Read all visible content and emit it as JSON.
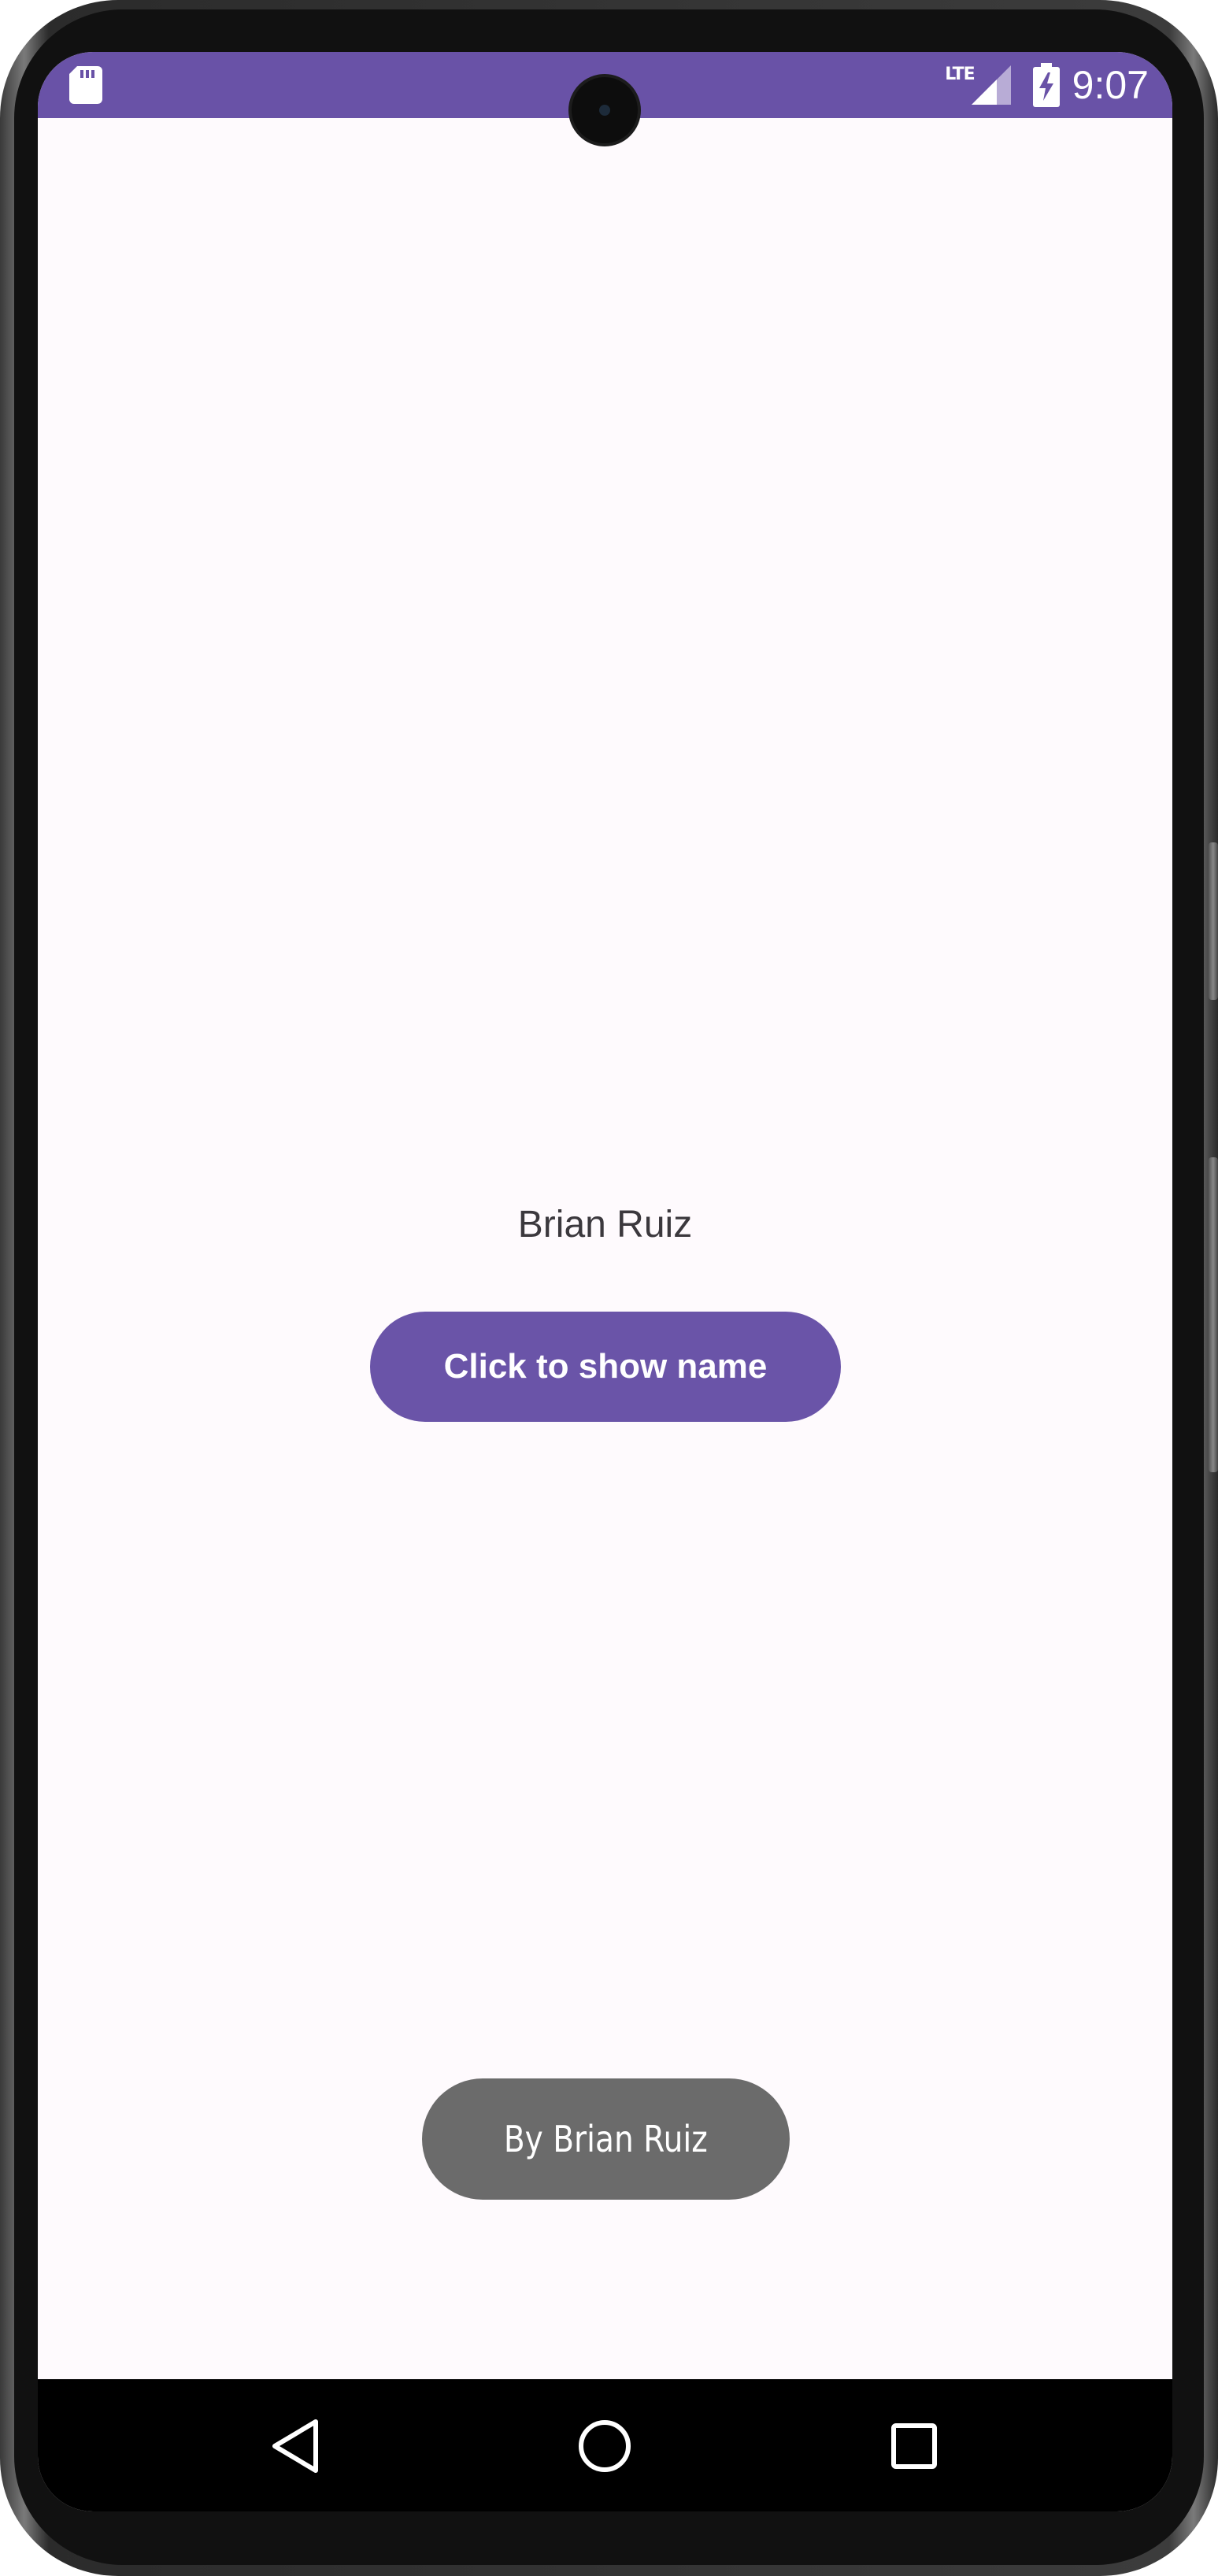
{
  "status_bar": {
    "time": "9:07",
    "network": "LTE",
    "icons": [
      "sd-card-icon",
      "signal-icon",
      "battery-charging-icon"
    ],
    "background_color": "#6952a7"
  },
  "main": {
    "name_text": "Brian Ruiz",
    "button_label": "Click to show name",
    "button_color": "#6a54a8"
  },
  "toast": {
    "text": "By Brian Ruiz"
  },
  "nav_bar": {
    "buttons": [
      "back-icon",
      "home-icon",
      "recents-icon"
    ]
  }
}
